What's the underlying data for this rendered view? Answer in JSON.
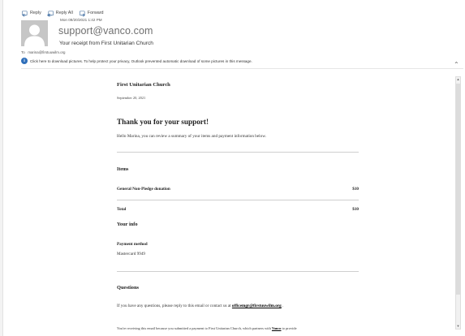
{
  "toolbar": {
    "reply": "Reply",
    "reply_all": "Reply All",
    "forward": "Forward"
  },
  "header": {
    "date": "Mon 09/20/2021 1:42 PM",
    "sender": "support@vanco.com",
    "subject": "Your receipt from First Unitarian Church",
    "to_label": "To",
    "to_address": "marina@firstuuwilm.org",
    "info_text": "Click here to download pictures. To help protect your privacy, Outlook prevented automatic download of some pictures in this message."
  },
  "receipt": {
    "org_name": "First Unitarian Church",
    "date": "September 20, 2021",
    "thanks": "Thank you for your support!",
    "greeting": "Hello Marina, you can review a summary of your items and payment information below.",
    "items_heading": "Items",
    "items": [
      {
        "name": "General Non-Pledge donation",
        "amount": "$10"
      }
    ],
    "total_label": "Total",
    "total_amount": "$10",
    "info_heading": "Your info",
    "payment_method_label": "Payment method",
    "payment_method_value": "Mastercard 9949",
    "questions_heading": "Questions",
    "questions_text_before": "If you have any questions, please reply to this email or contact us at ",
    "questions_email": "officemgr@firstuuwilm.org",
    "questions_text_after": " .",
    "footer_before": "You're receiving this email because you submitted a payment to First Unitarian Church, which partners with ",
    "footer_link": "Vanco",
    "footer_after": " to provide"
  },
  "colors": {
    "info_icon": "#2f6fba",
    "avatar_bg": "#c6c6c6",
    "sender_text": "#6f6f6f"
  },
  "icons": {
    "reply": "reply-icon",
    "reply_all": "reply-all-icon",
    "forward": "forward-icon",
    "info": "info-icon",
    "avatar": "person-silhouette"
  }
}
